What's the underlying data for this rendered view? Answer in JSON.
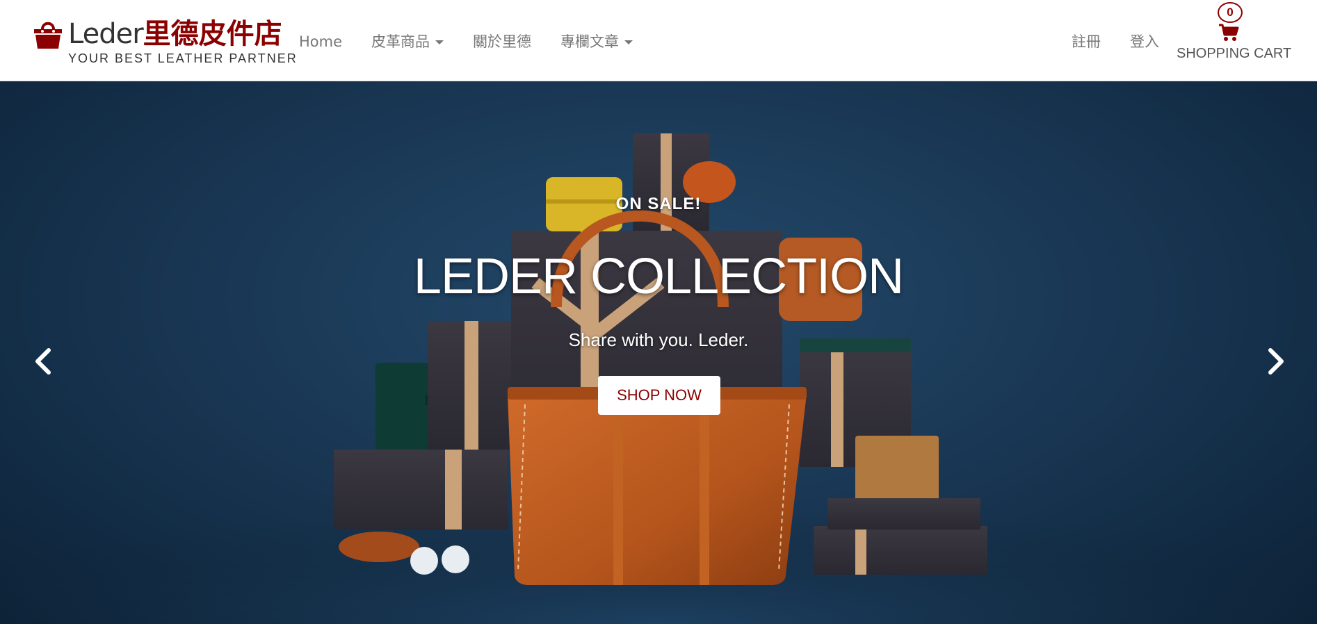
{
  "brand": {
    "name_latin": "Leder",
    "name_cn": "里德皮件店",
    "tagline": "YOUR BEST LEATHER PARTNER",
    "accent_color": "#8b0000",
    "logo_icon": "shopping-bag-icon"
  },
  "nav": {
    "left": [
      {
        "label": "Home",
        "dropdown": false
      },
      {
        "label": "皮革商品",
        "dropdown": true
      },
      {
        "label": "關於里德",
        "dropdown": false
      },
      {
        "label": "專欄文章",
        "dropdown": true
      }
    ],
    "right": [
      {
        "label": "註冊"
      },
      {
        "label": "登入"
      }
    ],
    "cart": {
      "count": "0",
      "label": "SHOPPING CART",
      "icon": "cart-icon"
    }
  },
  "hero": {
    "kicker": "ON SALE!",
    "title": "LEDER COLLECTION",
    "subtitle": "Share with you. Leder.",
    "cta_label": "SHOP NOW",
    "prev_icon": "chevron-left-icon",
    "next_icon": "chevron-right-icon",
    "background_color": "#1b3a58"
  }
}
